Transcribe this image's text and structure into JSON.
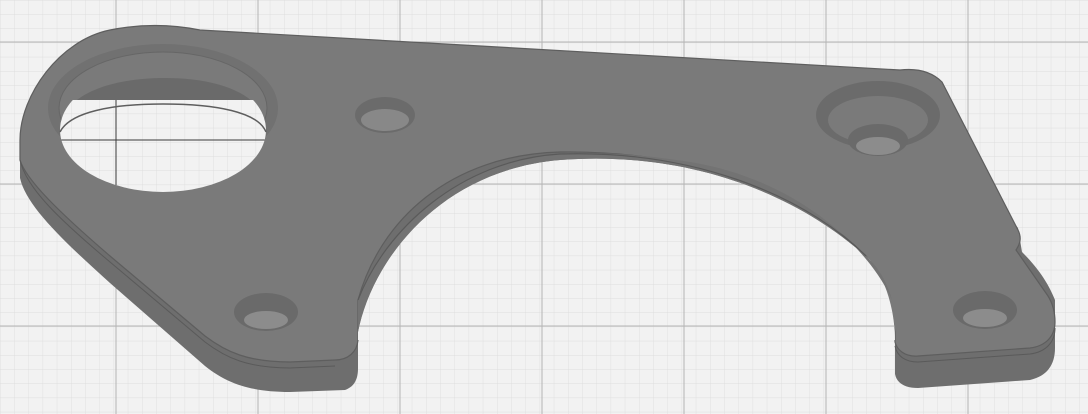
{
  "viewport": {
    "background_color": "#f2f2f2",
    "grid_minor_color": "#d9d9d9",
    "grid_major_color": "#b4b4b4",
    "grid_axis_color": "#3a3a3a"
  },
  "part": {
    "top_face_color": "#7a7a7a",
    "side_face_color": "#6e6e6e",
    "inner_wall_color": "#737373",
    "edge_color": "#5a5a5a",
    "hole_color": "#666666",
    "hole_inner_color": "#8a8a8a",
    "features": [
      "counterbored-large-hole",
      "small-bolt-hole",
      "counterbored-bolt-hole",
      "semicircular-cutout",
      "bolt-hole",
      "bolt-hole"
    ]
  }
}
